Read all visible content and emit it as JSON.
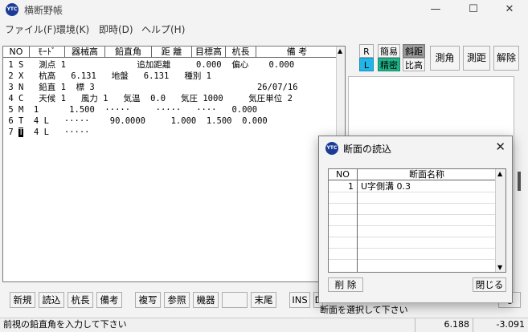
{
  "window": {
    "app_icon": "YTC",
    "title": "横断野帳",
    "minimize_glyph": "—",
    "maximize_glyph": "☐",
    "close_glyph": "✕"
  },
  "menu": [
    "ファイル(F)",
    "環境(K)",
    "即時(D)",
    "ヘルプ(H)"
  ],
  "table": {
    "headers": [
      "NO",
      "ﾓｰﾄﾞ",
      "器械高",
      "鉛直角",
      "距 離",
      "目標高",
      "杭長",
      "備   考"
    ],
    "rows": [
      " 1 S   測点 1              追加距離     0.000  偏心    0.000",
      " 2 X   杭高   6.131   地盤   6.131   種別 1",
      " 3 N   鉛直 1  標 3                                26/07/16",
      " 4 C   天候 1   風力 1   気温  0.0   気圧 1000     気圧単位 2",
      " 5 M  1      1.500  ·····     ·····   ····   0.000",
      " 6 T  4 L   ·····    90.0000     1.000  1.500  0.000",
      " 7    4 L   ·····"
    ],
    "row7_no": " 7",
    "row7_cursor": "T"
  },
  "toggles": {
    "r": "R",
    "l": "L",
    "kanni": "簡易",
    "seimitsu": "精密",
    "shakyori": "斜距",
    "hikou": "比高"
  },
  "side_buttons": [
    "測角",
    "測距",
    "解除"
  ],
  "toolbar": [
    "新規",
    "読込",
    "杭長",
    "備考",
    "複写",
    "参照",
    "機器",
    "",
    "末尾",
    "INS",
    "D"
  ],
  "status": {
    "message": "前視の鉛直角を入力して下さい",
    "dialog_message": "断面を選択して下さい",
    "value1": "6.188",
    "value2": "-3.091",
    "hidden_btn": "る"
  },
  "dialog": {
    "icon": "YTC",
    "title": "断面の読込",
    "close_glyph": "✕",
    "headers": [
      "NO",
      "断面名称"
    ],
    "rows": [
      {
        "no": "1",
        "name": "U字側溝 0.3"
      }
    ],
    "delete_label": "削 除",
    "close_label": "閉じる"
  }
}
